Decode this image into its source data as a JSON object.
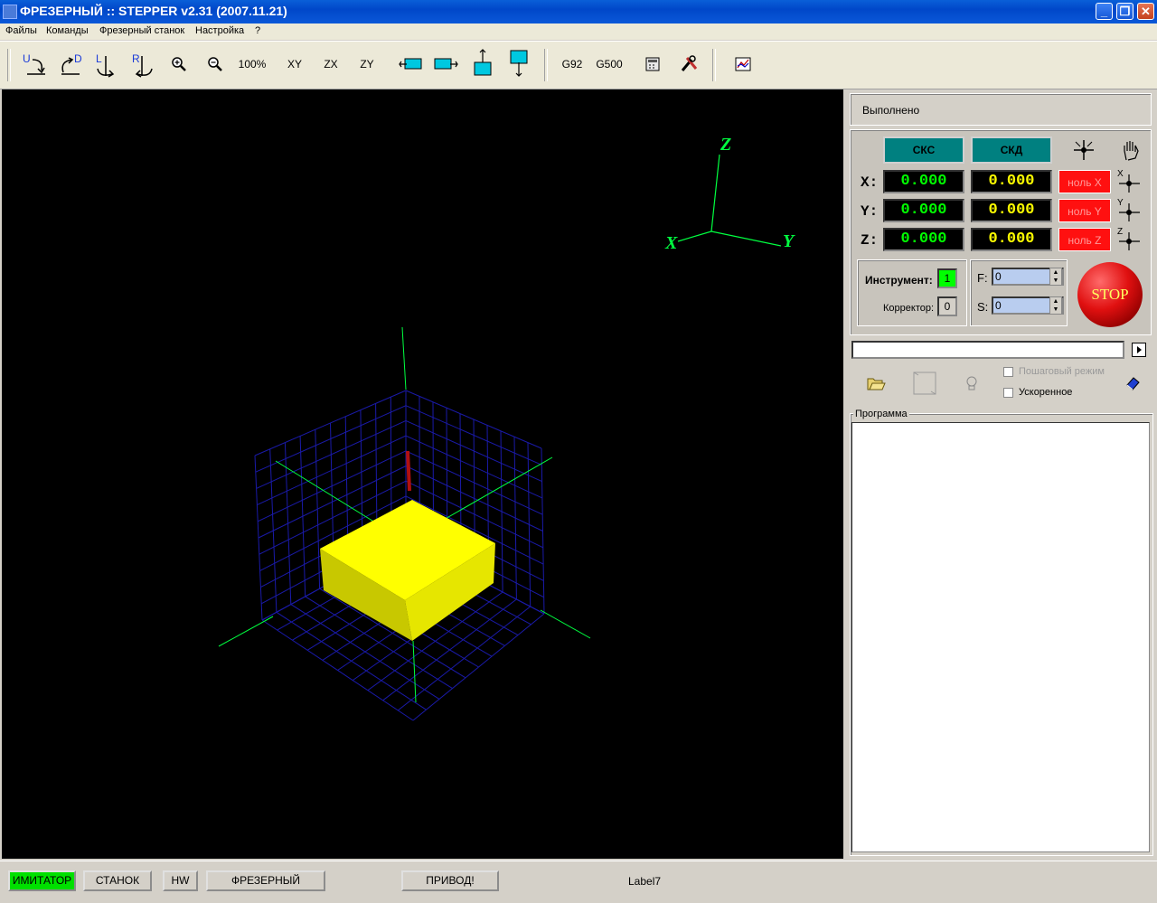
{
  "window": {
    "title": "ФРЕЗЕРНЫЙ :: STEPPER v2.31 (2007.11.21)",
    "minimize": "_",
    "maximize": "❐",
    "close": "✕"
  },
  "menu": [
    "Файлы",
    "Команды",
    "Фрезерный станок",
    "Настройка",
    "?"
  ],
  "toolbar": {
    "rot_u": "U",
    "rot_d": "D",
    "rot_l": "L",
    "rot_r": "R",
    "zoom100": "100%",
    "xy": "XY",
    "zx": "ZX",
    "zy": "ZY",
    "g92": "G92",
    "g500": "G500"
  },
  "view3d": {
    "axis_x": "X",
    "axis_y": "Y",
    "axis_z": "Z",
    "background": "#000000",
    "grid_color": "#1a1aa8",
    "axis_color": "#00ff40",
    "workpiece_color": "#ffff00",
    "tool_color": "#b01010"
  },
  "panel": {
    "status": "Выполнено",
    "sks": "СКС",
    "skd": "СКД",
    "axes": [
      {
        "label": "X:",
        "sks": "0.000",
        "skd": "0.000",
        "zero": "ноль X",
        "icon_letter": "X"
      },
      {
        "label": "Y:",
        "sks": "0.000",
        "skd": "0.000",
        "zero": "ноль Y",
        "icon_letter": "Y"
      },
      {
        "label": "Z:",
        "sks": "0.000",
        "skd": "0.000",
        "zero": "ноль Z",
        "icon_letter": "Z"
      }
    ],
    "instrument_label": "Инструмент:",
    "instrument_value": "1",
    "corrector_label": "Корректор:",
    "corrector_value": "0",
    "f_label": "F:",
    "f_value": "0",
    "s_label": "S:",
    "s_value": "0",
    "stop": "STOP",
    "command_value": "",
    "step_mode": "Пошаговый режим",
    "accelerated": "Ускоренное",
    "program_label": "Программа"
  },
  "statusbar": {
    "imitator": "ИМИТАТОР",
    "stanok": "СТАНОК",
    "hw": "HW",
    "frezerny": "ФРЕЗЕРНЫЙ",
    "privod": "ПРИВОД!",
    "label7": "Label7"
  }
}
